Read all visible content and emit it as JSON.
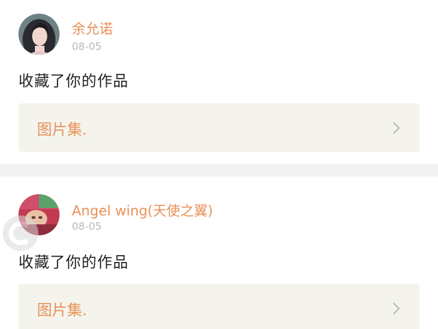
{
  "feed": {
    "items": [
      {
        "username": "余允诺",
        "date": "08-05",
        "action": "收藏了你的作品",
        "work_title": "图片集.",
        "avatar_icon": "user-avatar-girl"
      },
      {
        "username": "Angel wing(天使之翼)",
        "date": "08-05",
        "action": "收藏了你的作品",
        "work_title": "图片集.",
        "avatar_icon": "user-avatar-baby"
      }
    ]
  },
  "colors": {
    "accent": "#e8915a",
    "date": "#b9b9b9",
    "text": "#222222",
    "card_bg": "#f4f4ec",
    "divider": "#f2f2f2"
  }
}
